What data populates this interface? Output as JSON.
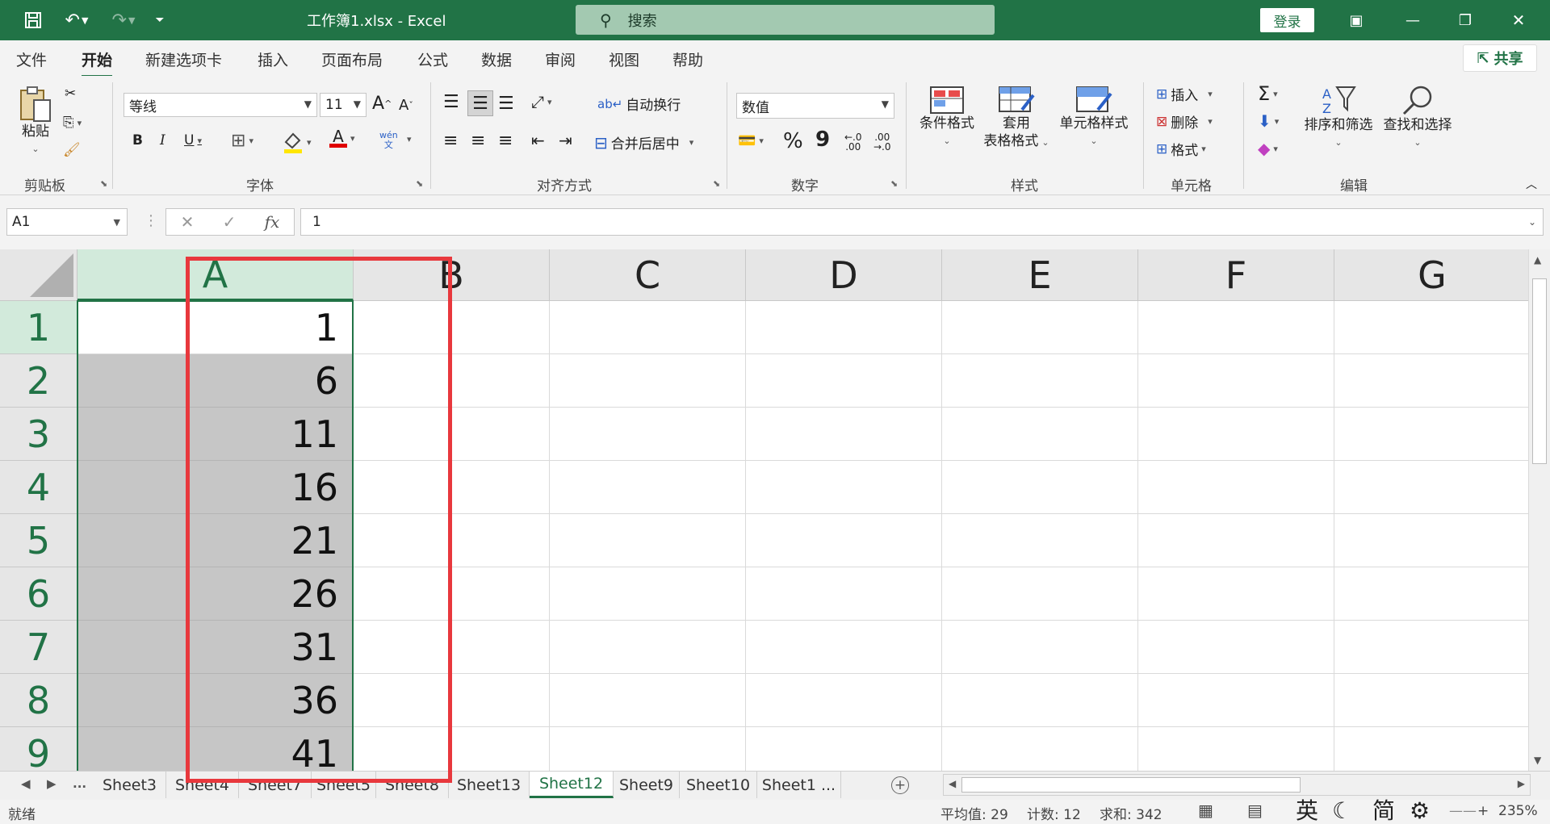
{
  "titlebar": {
    "filename": "工作簿1.xlsx  -  Excel",
    "search_placeholder": "搜索",
    "login": "登录"
  },
  "menu": {
    "tabs": [
      "文件",
      "开始",
      "新建选项卡",
      "插入",
      "页面布局",
      "公式",
      "数据",
      "审阅",
      "视图",
      "帮助"
    ],
    "active": "开始",
    "share": "共享"
  },
  "ribbon": {
    "clipboard": {
      "label": "剪贴板",
      "paste": "粘贴"
    },
    "font": {
      "label": "字体",
      "name": "等线",
      "size": "11",
      "bold": "B",
      "italic": "I",
      "underline": "U",
      "grow": "A",
      "shrink": "A",
      "color_glyph": "A",
      "phonetic": "wén"
    },
    "alignment": {
      "label": "对齐方式",
      "wrap": "自动换行",
      "merge": "合并后居中"
    },
    "number": {
      "label": "数字",
      "format": "数值",
      "percent": "%",
      "comma": "9",
      "inc_decimal": ".00",
      "dec_decimal": ".00"
    },
    "styles": {
      "label": "样式",
      "conditional": "条件格式",
      "table_line1": "套用",
      "table_line2": "表格格式",
      "cell_styles": "单元格样式"
    },
    "cells": {
      "label": "单元格",
      "insert": "插入",
      "delete": "删除",
      "format": "格式"
    },
    "editing": {
      "label": "编辑",
      "sort_filter": "排序和筛选",
      "find_select": "查找和选择"
    }
  },
  "formula_bar": {
    "name_box": "A1",
    "fx": "fx",
    "value": "1"
  },
  "sheet": {
    "columns": [
      "A",
      "B",
      "C",
      "D",
      "E",
      "F",
      "G"
    ],
    "rows": [
      "1",
      "2",
      "3",
      "4",
      "5",
      "6",
      "7",
      "8",
      "9"
    ],
    "column_a_values": [
      "1",
      "6",
      "11",
      "16",
      "21",
      "26",
      "31",
      "36",
      "41"
    ]
  },
  "sheet_tabs": {
    "more": "...",
    "tabs": [
      "Sheet3",
      "Sheet4",
      "Sheet7",
      "Sheet5",
      "Sheet8",
      "Sheet13",
      "Sheet12",
      "Sheet9",
      "Sheet10",
      "Sheet1 ..."
    ],
    "active": "Sheet12"
  },
  "status": {
    "ready": "就绪",
    "average": "平均值: 29",
    "count": "计数: 12",
    "sum": "求和: 342",
    "ime_lang": "英",
    "ime_mode": "简",
    "zoom": "235%"
  },
  "colors": {
    "excel_green": "#217346",
    "annotation_red": "#e8383d",
    "selection_gray": "#c6c6c6"
  }
}
